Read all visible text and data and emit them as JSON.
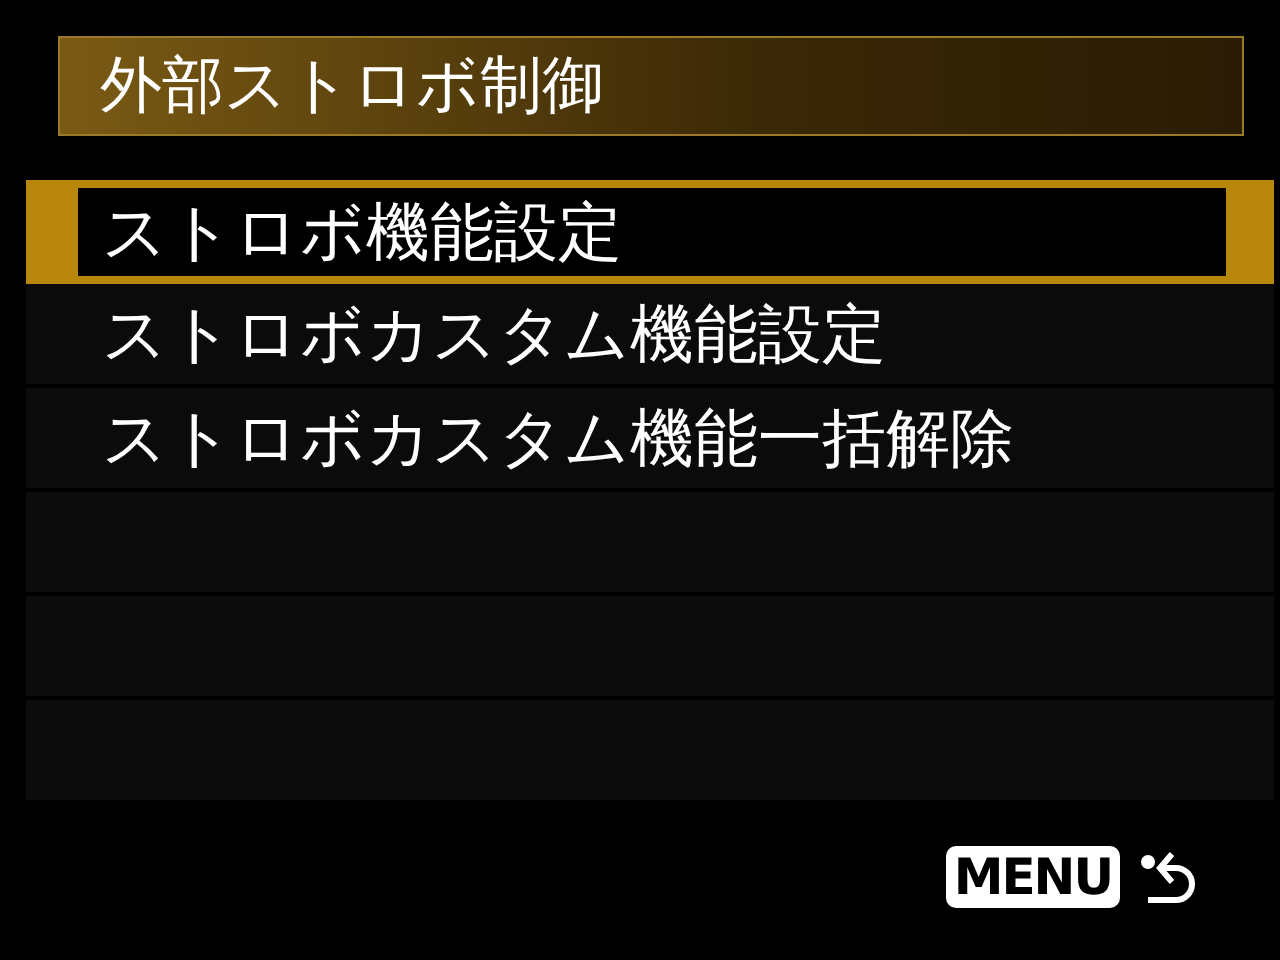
{
  "title": "外部ストロボ制御",
  "items": [
    {
      "label": "ストロボ機能設定",
      "selected": true
    },
    {
      "label": "ストロボカスタム機能設定",
      "selected": false
    },
    {
      "label": "ストロボカスタム機能一括解除",
      "selected": false
    }
  ],
  "footer": {
    "menu_key": "MENU"
  }
}
